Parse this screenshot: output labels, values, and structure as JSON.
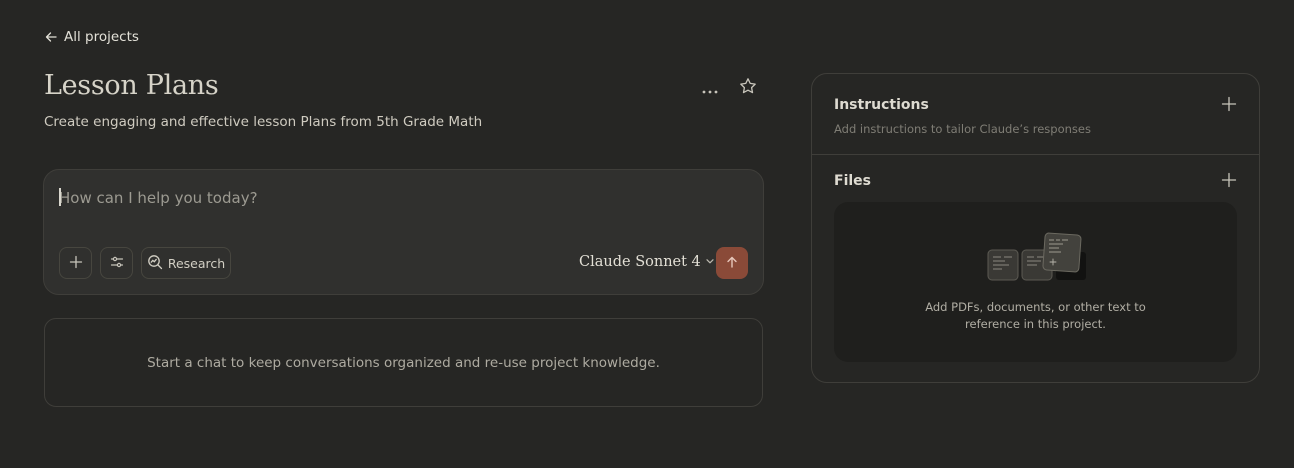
{
  "nav": {
    "back_label": "All projects"
  },
  "project": {
    "title": "Lesson Plans",
    "description": "Create engaging and effective lesson Plans from 5th Grade Math"
  },
  "composer": {
    "placeholder": "How can I help you today?",
    "research_label": "Research",
    "model_label": "Claude Sonnet 4",
    "send_color": "#8a4a38"
  },
  "chats": {
    "empty_text": "Start a chat to keep conversations organized and re-use project knowledge."
  },
  "knowledge": {
    "instructions": {
      "title": "Instructions",
      "subtitle": "Add instructions to tailor Claude’s responses"
    },
    "files": {
      "title": "Files",
      "dropzone_line1": "Add PDFs, documents, or other text to",
      "dropzone_line2": "reference in this project."
    }
  },
  "icons": {
    "back": "arrow-left-icon",
    "more": "more-horizontal-icon",
    "star": "star-icon",
    "add": "plus-icon",
    "tools": "sliders-icon",
    "research": "research-icon",
    "chevron": "chevron-down-icon",
    "send": "arrow-up-icon"
  }
}
